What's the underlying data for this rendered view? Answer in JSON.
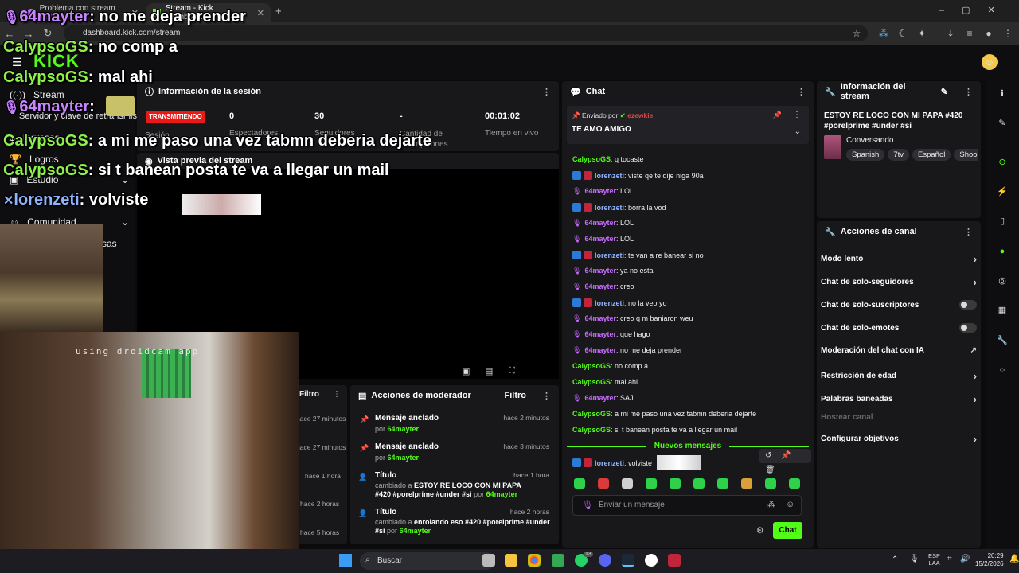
{
  "browser": {
    "tabs": [
      {
        "title": "Problema con stream key"
      },
      {
        "title": "Stream - Kick Dashboard"
      }
    ],
    "url": "dashboard.kick.com/stream"
  },
  "brand": {
    "logo": "KICK",
    "accent": "#53fc18"
  },
  "sidebar": {
    "items": [
      {
        "label": "Stream"
      },
      {
        "label": "Servidor y clave de retransmisión"
      },
      {
        "label": "Ingresos"
      },
      {
        "label": "Logros"
      },
      {
        "label": "Estudio"
      },
      {
        "label": "Comunidad"
      },
      {
        "label": "sas"
      }
    ]
  },
  "session": {
    "title": "Información de la sesión",
    "status": "TRANSMITIENDO",
    "stats": [
      {
        "value": "0",
        "label": "Espectadores"
      },
      {
        "value": "30",
        "label": "Seguidores"
      },
      {
        "value": "-",
        "label": "Cantidad de suscripciones"
      },
      {
        "value": "00:01:02",
        "label": "Tiempo en vivo"
      }
    ],
    "sesion_label": "Sesión"
  },
  "preview": {
    "title": "Vista previa del stream"
  },
  "leftfeed": {
    "filter": "Filtro",
    "times": [
      "hace 27 minutos",
      "hace 27 minutos",
      "hace 1 hora",
      "hace 2 horas",
      "hace 5 horas"
    ]
  },
  "modactions": {
    "title": "Acciones de moderador",
    "filter": "Filtro",
    "items": [
      {
        "title": "Mensaje anclado",
        "by": "por",
        "user": "64mayter",
        "time": "hace 2 minutos"
      },
      {
        "title": "Mensaje anclado",
        "by": "por",
        "user": "64mayter",
        "time": "hace 3 minutos"
      },
      {
        "title": "Título",
        "changed": "cambiado a",
        "value": "ESTOY RE LOCO CON MI PAPA #420 #porelprime #under #si",
        "by": "por",
        "user": "64mayter",
        "time": "hace 1 hora"
      },
      {
        "title": "Título",
        "changed": "cambiado a",
        "value": "enrolando eso #420 #porelprime #under #si",
        "by": "por",
        "user": "64mayter",
        "time": "hace 2 horas"
      }
    ]
  },
  "chat": {
    "title": "Chat",
    "pinned": {
      "label": "Enviado por",
      "user": "ezewkie",
      "text": "TE AMO AMIGO"
    },
    "messages": [
      {
        "user": "CalypsoGS",
        "text": "q tocaste",
        "kind": "cal"
      },
      {
        "user": "lorenzeti",
        "text": "viste qe te dije niga 90a",
        "kind": "lor"
      },
      {
        "user": "64mayter",
        "text": "LOL",
        "kind": "64"
      },
      {
        "user": "lorenzeti",
        "text": "borra la vod",
        "kind": "lor"
      },
      {
        "user": "64mayter",
        "text": "LOL",
        "kind": "64"
      },
      {
        "user": "64mayter",
        "text": "LOL",
        "kind": "64"
      },
      {
        "user": "lorenzeti",
        "text": "te van a re banear si no",
        "kind": "lor"
      },
      {
        "user": "64mayter",
        "text": "ya no esta",
        "kind": "64"
      },
      {
        "user": "64mayter",
        "text": "creo",
        "kind": "64"
      },
      {
        "user": "lorenzeti",
        "text": "no la veo yo",
        "kind": "lor"
      },
      {
        "user": "64mayter",
        "text": "creo q m baniaron weu",
        "kind": "64"
      },
      {
        "user": "64mayter",
        "text": "que hago",
        "kind": "64"
      },
      {
        "user": "64mayter",
        "text": "no me deja prender",
        "kind": "64"
      },
      {
        "user": "CalypsoGS",
        "text": "no comp a",
        "kind": "cal"
      },
      {
        "user": "CalypsoGS",
        "text": "mal ahi",
        "kind": "cal"
      },
      {
        "user": "64mayter",
        "text": "SAJ",
        "kind": "64"
      },
      {
        "user": "CalypsoGS",
        "text": "a mi me paso una vez tabmn deberia dejarte",
        "kind": "cal"
      },
      {
        "user": "CalypsoGS",
        "text": "si t banean posta te va a llegar un mail",
        "kind": "cal"
      }
    ],
    "new_messages": "Nuevos mensajes",
    "last": {
      "user": "lorenzeti",
      "text": "volviste"
    },
    "placeholder": "Enviar un mensaje",
    "send": "Chat"
  },
  "streaminfo": {
    "title": "Información del stream",
    "stream_title": "ESTOY RE LOCO CON MI PAPA #420 #porelprime #under #si",
    "category": "Conversando",
    "tags": [
      "Spanish",
      "7tv",
      "Español",
      "Shoo"
    ]
  },
  "channel": {
    "title": "Acciones de canal",
    "actions": [
      {
        "label": "Modo lento",
        "control": "chevron"
      },
      {
        "label": "Chat de solo-seguidores",
        "control": "chevron"
      },
      {
        "label": "Chat de solo-suscriptores",
        "control": "toggle"
      },
      {
        "label": "Chat de solo-emotes",
        "control": "toggle"
      },
      {
        "label": "Moderación del chat con IA",
        "control": "external"
      },
      {
        "label": "Restricción de edad",
        "control": "chevron"
      },
      {
        "label": "Palabras baneadas",
        "control": "chevron"
      },
      {
        "label": "Hostear canal",
        "control": "disabled"
      },
      {
        "label": "Configurar objetivos",
        "control": "chevron"
      }
    ]
  },
  "overlay": {
    "lines": [
      {
        "user": "64mayter",
        "text": "no me deja prender",
        "kind": "p"
      },
      {
        "user": "CalypsoGS",
        "text": "no comp a",
        "kind": "n"
      },
      {
        "user": "CalypsoGS",
        "text": "mal ahi",
        "kind": "n"
      },
      {
        "user": "64mayter",
        "text": "",
        "kind": "p"
      },
      {
        "user": "CalypsoGS",
        "text": "a mi me paso una vez tabmn deberia dejarte",
        "kind": "n"
      },
      {
        "user": "CalypsoGS",
        "text": "si t banean posta te va a llegar un mail",
        "kind": "n"
      },
      {
        "user": "lorenzeti",
        "text": "volviste",
        "kind": "b"
      }
    ],
    "cam_text": "using droidcam app"
  },
  "taskbar": {
    "search": "Buscar",
    "lang1": "ESP",
    "lang2": "LAA",
    "time": "20:29",
    "date": "15/2/2026",
    "badge": "13"
  }
}
